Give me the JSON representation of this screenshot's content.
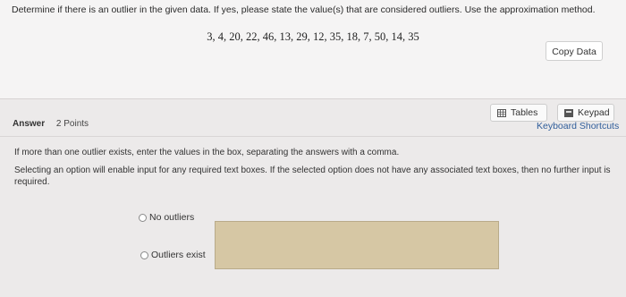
{
  "question": {
    "prompt": "Determine if there is an outlier in the given data. If yes, please state the value(s) that are considered outliers. Use the approximation method.",
    "data_values": "3, 4, 20, 22, 46, 13, 29, 12, 35, 18, 7, 50, 14, 35",
    "copy_label": "Copy Data"
  },
  "answer": {
    "label": "Answer",
    "points": "2 Points",
    "tables_label": "Tables",
    "keypad_label": "Keypad",
    "shortcuts_label": "Keyboard Shortcuts",
    "instruction_1": "If more than one outlier exists, enter the values in the box, separating the answers with a comma.",
    "instruction_2": "Selecting an option will enable input for any required text boxes. If the selected option does not have any associated text boxes, then no further input is required.",
    "options": [
      {
        "label": "No outliers"
      },
      {
        "label": "Outliers exist"
      }
    ],
    "outliers_input_value": ""
  },
  "colors": {
    "input_fill": "#d6c7a4",
    "link": "#2f5d9a"
  }
}
